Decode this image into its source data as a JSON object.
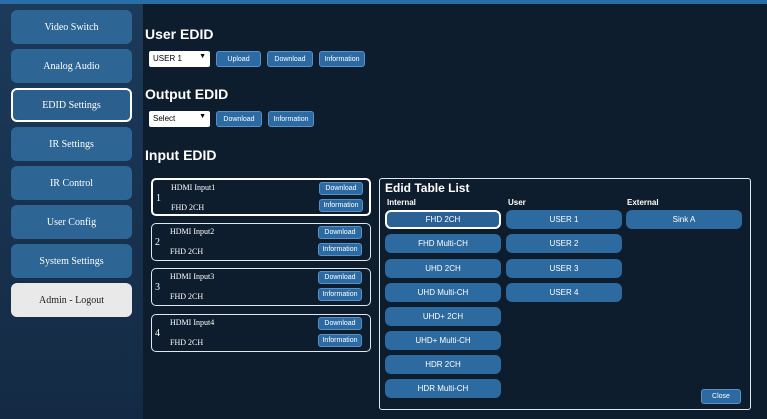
{
  "sidebar": {
    "items": [
      "Video Switch",
      "Analog Audio",
      "EDID Settings",
      "IR Settings",
      "IR Control",
      "User Config",
      "System Settings",
      "Admin - Logout"
    ]
  },
  "user_edid": {
    "heading": "User EDID",
    "select_value": "USER 1",
    "buttons": [
      "Upload",
      "Download",
      "Information"
    ]
  },
  "output_edid": {
    "heading": "Output EDID",
    "select_value": "Select",
    "buttons": [
      "Download",
      "Information"
    ]
  },
  "input_edid": {
    "heading": "Input EDID",
    "inputs": [
      {
        "name": "HDMI Input1",
        "num": "1",
        "edid": "FHD 2CH",
        "download": "Download",
        "information": "Information"
      },
      {
        "name": "HDMI Input2",
        "num": "2",
        "edid": "FHD 2CH",
        "download": "Download",
        "information": "Information"
      },
      {
        "name": "HDMI Input3",
        "num": "3",
        "edid": "FHD 2CH",
        "download": "Download",
        "information": "Information"
      },
      {
        "name": "HDMI Input4",
        "num": "4",
        "edid": "FHD 2CH",
        "download": "Download",
        "information": "Information"
      }
    ]
  },
  "edid_table": {
    "title": "Edid Table List",
    "columns": [
      "Internal",
      "User",
      "External"
    ],
    "internal": [
      "FHD 2CH",
      "FHD Multi-CH",
      "UHD 2CH",
      "UHD Multi-CH",
      "UHD+ 2CH",
      "UHD+ Multi-CH",
      "HDR 2CH",
      "HDR Multi-CH"
    ],
    "user": [
      "USER 1",
      "USER 2",
      "USER 3",
      "USER 4"
    ],
    "external": [
      "Sink A"
    ],
    "close": "Close"
  },
  "colors": {
    "accent": "#2d6a9f",
    "background": "#0e1d2d"
  }
}
